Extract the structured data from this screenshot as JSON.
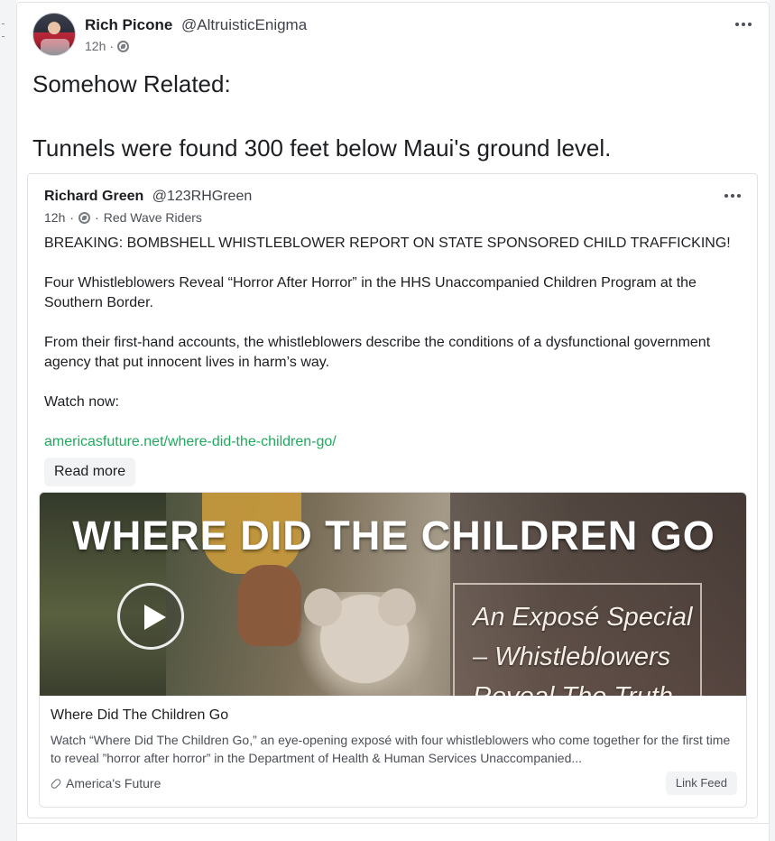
{
  "post": {
    "author_name": "Rich Picone",
    "author_handle": "@AltruisticEnigma",
    "time": "12h",
    "dot": "·",
    "text_line1": "Somehow Related:",
    "text_line2": "Tunnels were found 300 feet below Maui's ground level."
  },
  "shared": {
    "author_name": "Richard Green",
    "author_handle": "@123RHGreen",
    "time": "12h",
    "dot1": "·",
    "dot2": "·",
    "group": "Red Wave Riders",
    "para1": "BREAKING: BOMBSHELL WHISTLEBLOWER REPORT ON STATE SPONSORED CHILD TRAFFICKING!",
    "para2": "Four Whistleblowers Reveal “Horror After Horror” in the HHS Unaccompanied Children Program at the Southern Border.",
    "para3": "From their first-hand accounts, the whistleblowers describe the conditions of a dysfunctional government agency that put innocent lives in harm’s way.",
    "para4": "Watch now:",
    "link": "americasfuture.net/where-did-the-children-go/",
    "read_more": "Read more"
  },
  "preview": {
    "thumb_title": "WHERE DID THE CHILDREN GO",
    "thumb_sub1": "An Exposé Special",
    "thumb_sub2": "– Whistleblowers",
    "thumb_sub3": "Reveal The Truth",
    "title": "Where Did The Children Go",
    "description": "Watch “Where Did The Children Go,” an eye-opening exposé with four whistleblowers who come together for the first time to reveal ”horror after horror” in the Department of Health & Human Services Unaccompanied...",
    "source": "America's Future",
    "link_feed": "Link Feed"
  },
  "colors": {
    "link": "#1faa5d",
    "text": "#1c1e21",
    "muted": "#65676b",
    "border": "#dfe1e5"
  },
  "icons": [
    "globe-icon",
    "more-options-icon",
    "play-icon",
    "link-icon"
  ]
}
